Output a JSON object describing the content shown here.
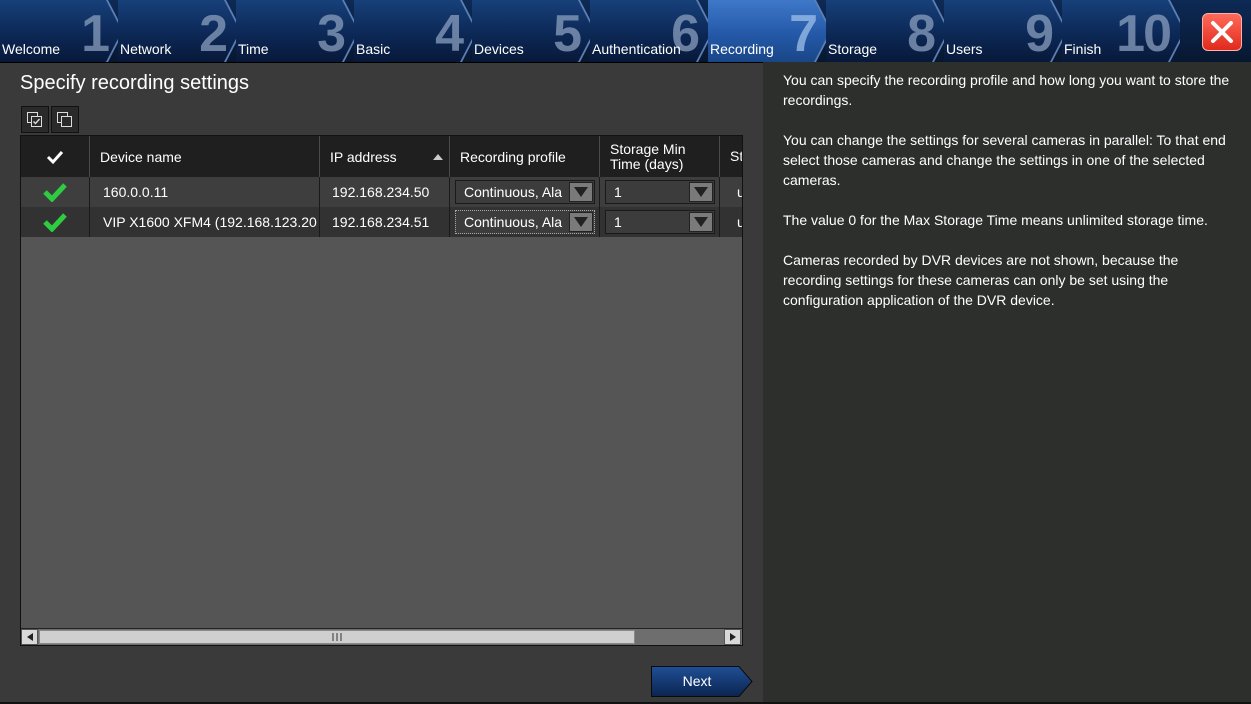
{
  "wizard": {
    "steps": [
      {
        "num": "1",
        "label": "Welcome"
      },
      {
        "num": "2",
        "label": "Network"
      },
      {
        "num": "3",
        "label": "Time"
      },
      {
        "num": "4",
        "label": "Basic"
      },
      {
        "num": "5",
        "label": "Devices"
      },
      {
        "num": "6",
        "label": "Authentication"
      },
      {
        "num": "7",
        "label": "Recording",
        "active": true
      },
      {
        "num": "8",
        "label": "Storage"
      },
      {
        "num": "9",
        "label": "Users"
      },
      {
        "num": "10",
        "label": "Finish"
      }
    ],
    "close_icon": "close-x-icon",
    "accent_color": "#2459a8"
  },
  "page": {
    "title": "Specify recording settings",
    "toolbar": {
      "select_all_icon": "select-all-icon",
      "copy_icon": "copy-icon"
    }
  },
  "table": {
    "columns": [
      {
        "label": ""
      },
      {
        "label": "Device name"
      },
      {
        "label": "IP address",
        "sorted": "ascending"
      },
      {
        "label": "Recording profile"
      },
      {
        "label": "Storage Min Time (days)"
      },
      {
        "label": "St Ti"
      }
    ],
    "header_check_icon": "checkmark-icon",
    "rows": [
      {
        "status_icon": "green-check-icon",
        "device": "160.0.0.11",
        "ip": "192.168.234.50",
        "profile": "Continuous, Ala",
        "min_time": "1",
        "max_time": "u"
      },
      {
        "status_icon": "green-check-icon",
        "device": "VIP X1600 XFM4 (192.168.123.20",
        "ip": "192.168.234.51",
        "profile": "Continuous, Ala",
        "min_time": "1",
        "max_time": "u"
      }
    ]
  },
  "buttons": {
    "next": "Next"
  },
  "help": {
    "paragraphs": [
      "You can specify the recording profile and how long you want to store the recordings.",
      "You can change the settings for several cameras in parallel: To that end select those cameras and change the settings in one of the selected cameras.",
      "The value 0 for the Max Storage Time means unlimited storage time.",
      "Cameras recorded by DVR devices are not shown, because the recording settings for these cameras can only be set using the configuration application of the DVR device."
    ]
  }
}
